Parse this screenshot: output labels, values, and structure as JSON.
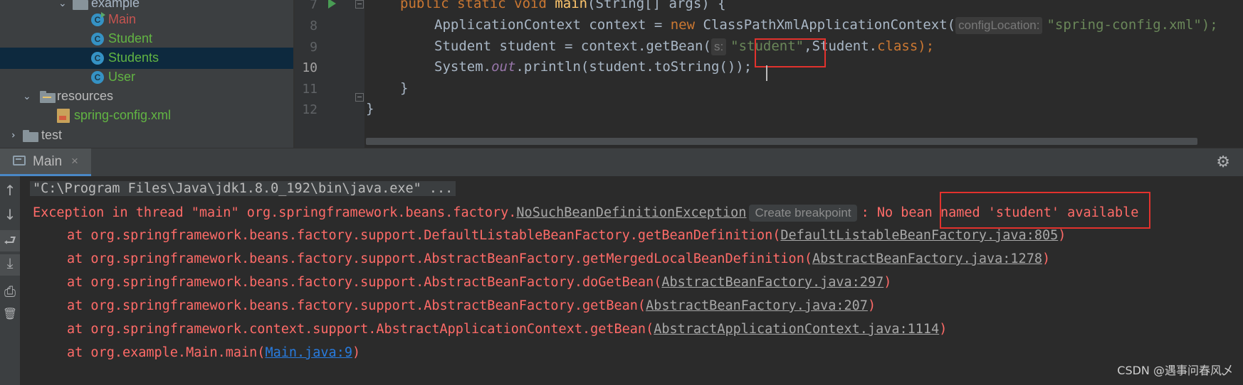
{
  "project_tree": {
    "items": [
      {
        "label": "example"
      },
      {
        "label": "Main"
      },
      {
        "label": "Student"
      },
      {
        "label": "Students"
      },
      {
        "label": "User"
      },
      {
        "label": "resources"
      },
      {
        "label": "spring-config.xml"
      },
      {
        "label": "test"
      }
    ]
  },
  "editor": {
    "line_numbers": [
      "7",
      "8",
      "9",
      "10",
      "11",
      "12"
    ],
    "lines": {
      "l7": {
        "kw1": "public static void ",
        "fn": "main",
        "rest": "(String[] args) {"
      },
      "l8": {
        "a": "ApplicationContext context = ",
        "kw": "new",
        "b": " ClassPathXmlApplicationContext(",
        "hint": "configLocation:",
        "str": "\"spring-config.xml\");"
      },
      "l9": {
        "a": "Student student = context.getBean(",
        "hint": "s:",
        "str": "\"student\"",
        "b": ",Student.",
        "kw": "class",
        "c": ");"
      },
      "l10": {
        "a": "System.",
        "static": "out",
        "b": ".println(student.",
        "c": "toString",
        "d": "());"
      },
      "l11": {
        "a": "}"
      },
      "l12": {
        "a": "}"
      }
    }
  },
  "run_window": {
    "tab_label": "Main",
    "tab_close": "×",
    "gear_glyph": "⚙",
    "console": {
      "cmd_line": "\"C:\\Program Files\\Java\\jdk1.8.0_192\\bin\\java.exe\" ...",
      "exception_prefix": "Exception in thread \"main\" org.springframework.beans.factory.",
      "exception_class": "NoSuchBeanDefinitionException",
      "create_breakpoint": "Create breakpoint",
      "exception_sep": ": ",
      "exception_msg": "No bean named 'student'",
      "exception_tail": " available",
      "stack": [
        {
          "text": "at org.springframework.beans.factory.support.DefaultListableBeanFactory.getBeanDefinition(",
          "link": "DefaultListableBeanFactory.java:805",
          "end": ")"
        },
        {
          "text": "at org.springframework.beans.factory.support.AbstractBeanFactory.getMergedLocalBeanDefinition(",
          "link": "AbstractBeanFactory.java:1278",
          "end": ")"
        },
        {
          "text": "at org.springframework.beans.factory.support.AbstractBeanFactory.doGetBean(",
          "link": "AbstractBeanFactory.java:297",
          "end": ")"
        },
        {
          "text": "at org.springframework.beans.factory.support.AbstractBeanFactory.getBean(",
          "link": "AbstractBeanFactory.java:207",
          "end": ")"
        },
        {
          "text": "at org.springframework.context.support.AbstractApplicationContext.getBean(",
          "link": "AbstractApplicationContext.java:1114",
          "end": ")"
        },
        {
          "text": "at org.example.Main.main(",
          "link": "Main.java:9",
          "end": ")"
        }
      ]
    }
  },
  "toolbar_glyphs": {
    "up": "↑",
    "down": "↓",
    "wrap": "⮐",
    "scroll_end": "⤓",
    "print": "⎙",
    "trash": "🗑"
  },
  "watermark": "CSDN @遇事问春风乄",
  "colors": {
    "error": "#ff6b68",
    "highlight_box": "#e2322d",
    "link_blue": "#287bde",
    "string": "#6a8759",
    "keyword": "#cc7832"
  }
}
